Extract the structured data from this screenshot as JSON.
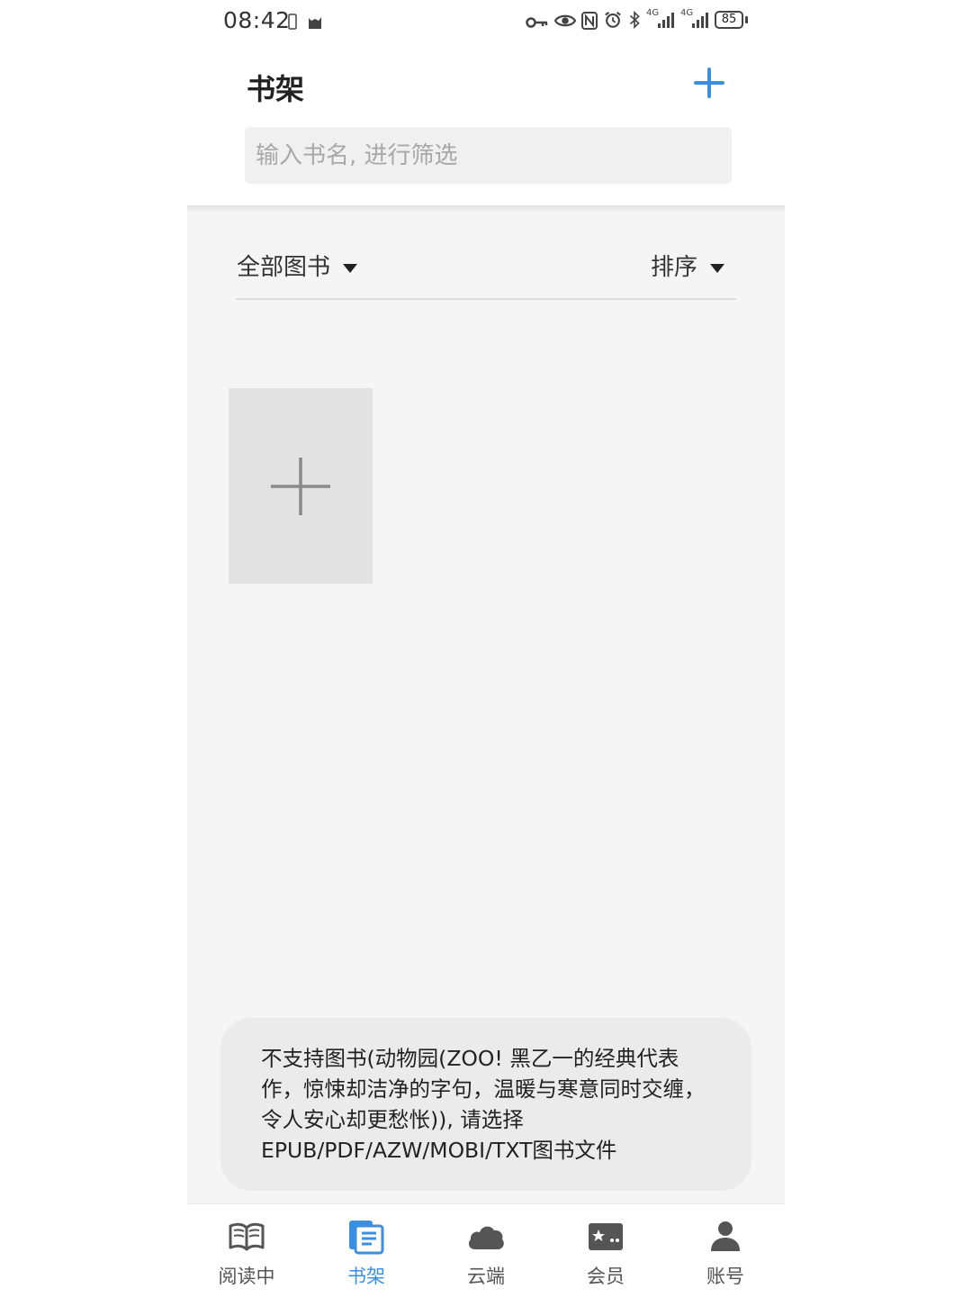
{
  "status_bar": {
    "time": "08:42",
    "battery": "85",
    "network_1": "4G",
    "network_2": "4G",
    "icons": [
      "phone-icon",
      "cat-icon",
      "key-icon",
      "eye-icon",
      "nfc-icon",
      "alarm-icon",
      "bluetooth-icon",
      "signal-icon",
      "signal-icon",
      "battery-icon"
    ]
  },
  "header": {
    "title": "书架",
    "add_icon": "plus-icon"
  },
  "search": {
    "placeholder": "输入书名, 进行筛选",
    "value": ""
  },
  "filters": {
    "category": "全部图书",
    "sort": "排序"
  },
  "add_book_icon": "plus-icon",
  "toast": {
    "message": "不支持图书(动物园(ZOO!  黑乙一的经典代表作，惊悚却洁净的字句，温暖与寒意同时交缠，令人安心却更愁怅)), 请选择EPUB/PDF/AZW/MOBI/TXT图书文件"
  },
  "nav": {
    "items": [
      {
        "label": "阅读中",
        "icon": "open-book-icon",
        "active": false
      },
      {
        "label": "书架",
        "icon": "bookshelf-icon",
        "active": true
      },
      {
        "label": "云端",
        "icon": "cloud-icon",
        "active": false
      },
      {
        "label": "会员",
        "icon": "member-card-icon",
        "active": false
      },
      {
        "label": "账号",
        "icon": "user-icon",
        "active": false
      }
    ]
  },
  "colors": {
    "accent": "#3b8fe0",
    "background": "#f5f5f5",
    "toast_background": "#ebebeb",
    "placeholder_tile": "#e2e2e2"
  }
}
